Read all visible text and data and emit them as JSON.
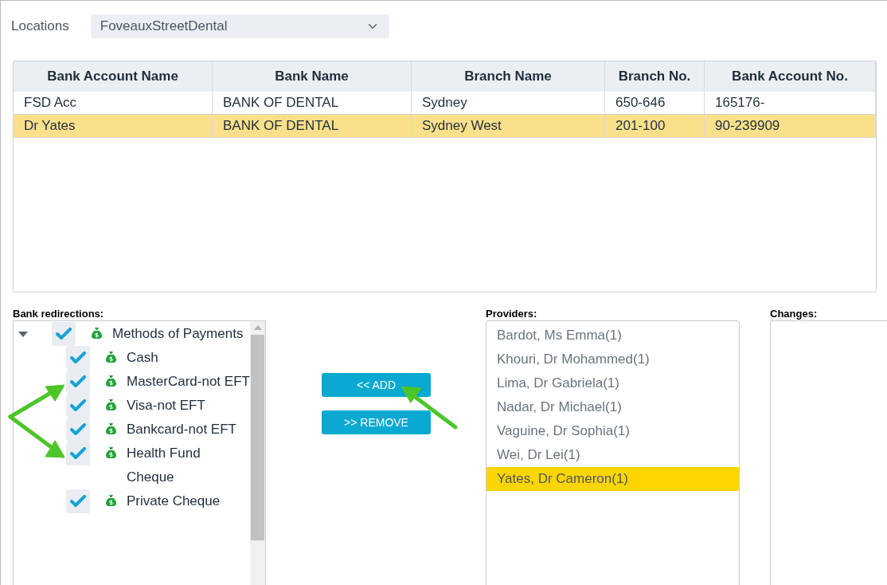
{
  "locations": {
    "label": "Locations",
    "value": "FoveauxStreetDental"
  },
  "table": {
    "columns": [
      "Bank Account Name",
      "Bank Name",
      "Branch Name",
      "Branch No.",
      "Bank Account No."
    ],
    "rows": [
      {
        "cells": [
          "FSD Acc",
          "BANK OF DENTAL",
          "Sydney",
          "650-646",
          "165176-"
        ],
        "selected": false
      },
      {
        "cells": [
          "Dr Yates",
          "BANK OF DENTAL",
          "Sydney West",
          "201-100",
          "90-239909"
        ],
        "selected": true
      }
    ]
  },
  "bank_redirections": {
    "label": "Bank redirections:",
    "tree": [
      {
        "label": "Methods of Payments",
        "expanded": true,
        "checked": true,
        "children": [
          {
            "label": "Cash",
            "checked": true
          },
          {
            "label": "MasterCard-not EFT",
            "checked": true
          },
          {
            "label": "Visa-not EFT",
            "checked": true
          },
          {
            "label": "Bankcard-not EFT",
            "checked": true
          },
          {
            "label": "Health Fund Cheque",
            "checked": true
          },
          {
            "label": "Private Cheque",
            "checked": true
          }
        ]
      }
    ]
  },
  "buttons": [
    "<< ADD",
    ">> REMOVE"
  ],
  "providers": {
    "label": "Providers:",
    "items": [
      {
        "label": "Bardot, Ms Emma(1)",
        "selected": false
      },
      {
        "label": "Khouri, Dr Mohammed(1)",
        "selected": false
      },
      {
        "label": "Lima, Dr Gabriela(1)",
        "selected": false
      },
      {
        "label": "Nadar, Dr Michael(1)",
        "selected": false
      },
      {
        "label": "Vaguine, Dr Sophia(1)",
        "selected": false
      },
      {
        "label": "Wei, Dr Lei(1)",
        "selected": false
      },
      {
        "label": "Yates, Dr Cameron(1)",
        "selected": true
      }
    ]
  },
  "changes": {
    "label": "Changes:"
  }
}
